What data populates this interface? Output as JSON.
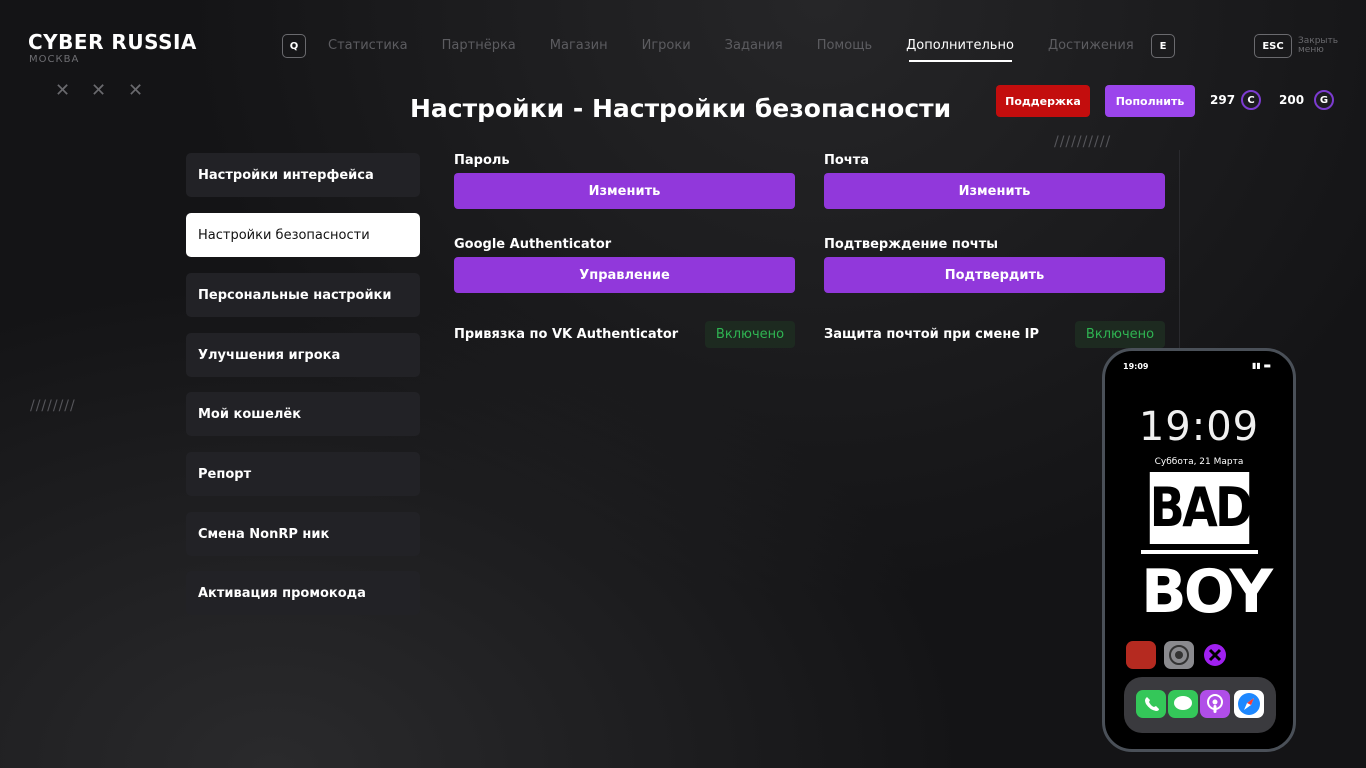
{
  "brand": {
    "name": "CYBER RUSSIA",
    "city": "МОСКВА"
  },
  "header": {
    "left_key": "Q",
    "right_key": "E",
    "nav": [
      "Статистика",
      "Партнёрка",
      "Магазин",
      "Игроки",
      "Задания",
      "Помощь",
      "Дополнительно",
      "Достижения"
    ],
    "active_nav": "Дополнительно",
    "esc_key": "ESC",
    "close_label": "Закрыть меню"
  },
  "page_title": "Настройки - Настройки безопасности",
  "actions": {
    "support": "Поддержка",
    "topup": "Пополнить"
  },
  "balances": [
    {
      "value": "297",
      "symbol": "C"
    },
    {
      "value": "200",
      "symbol": "G"
    }
  ],
  "sidebar": {
    "items": [
      "Настройки интерфейса",
      "Настройки безопасности",
      "Персональные настройки",
      "Улучшения игрока",
      "Мой кошелёк",
      "Репорт",
      "Смена NonRP ник",
      "Активация промокода"
    ],
    "active_index": 1
  },
  "settings": {
    "password": {
      "label": "Пароль",
      "button": "Изменить"
    },
    "email": {
      "label": "Почта",
      "button": "Изменить"
    },
    "google_auth": {
      "label": "Google Authenticator",
      "button": "Управление"
    },
    "email_confirm": {
      "label": "Подтверждение почты",
      "button": "Подтвердить"
    },
    "vk_auth": {
      "label": "Привязка по VK Authenticator",
      "status": "Включено"
    },
    "ip_protect": {
      "label": "Защита почтой при смене IP",
      "status": "Включено"
    }
  },
  "phone": {
    "status_time": "19:09",
    "clock": "19:09",
    "date": "Суббота, 21 Марта",
    "wallpaper_top": "BAD",
    "wallpaper_bottom": "BOY",
    "apps": [
      "game-app-icon",
      "settings-app-icon",
      "cyber-app-icon"
    ],
    "dock": [
      "phone-app-icon",
      "messages-app-icon",
      "podcasts-app-icon",
      "safari-app-icon"
    ]
  },
  "colors": {
    "accent": "#9138db",
    "support": "#c30d0d",
    "topup": "#9b45ec",
    "status_on": "#2fb452"
  }
}
